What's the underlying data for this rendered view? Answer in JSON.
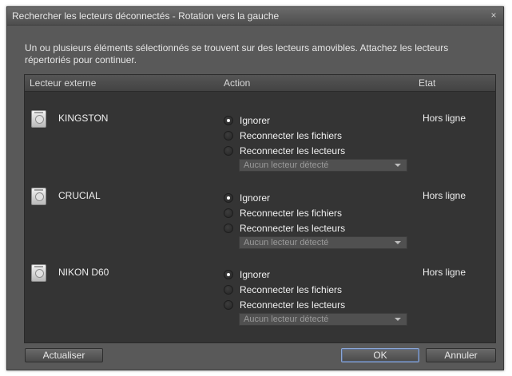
{
  "window": {
    "title": "Rechercher les lecteurs déconnectés - Rotation vers la gauche",
    "close_glyph": "×"
  },
  "message": "Un ou plusieurs éléments sélectionnés se trouvent sur des lecteurs amovibles. Attachez les lecteurs répertoriés pour continuer.",
  "table": {
    "headers": {
      "drive": "Lecteur externe",
      "action": "Action",
      "status": "Etat"
    },
    "rows": [
      {
        "icon": "removable-drive-icon",
        "name": "KINGSTON",
        "options": [
          "Ignorer",
          "Reconnecter les fichiers",
          "Reconnecter les lecteurs"
        ],
        "selected_option": "Ignorer",
        "dropdown": "Aucun lecteur détecté",
        "status": "Hors ligne"
      },
      {
        "icon": "removable-drive-icon",
        "name": "CRUCIAL",
        "options": [
          "Ignorer",
          "Reconnecter les fichiers",
          "Reconnecter les lecteurs"
        ],
        "selected_option": "Ignorer",
        "dropdown": "Aucun lecteur détecté",
        "status": "Hors ligne"
      },
      {
        "icon": "removable-drive-icon",
        "name": "NIKON D60",
        "options": [
          "Ignorer",
          "Reconnecter les fichiers",
          "Reconnecter les lecteurs"
        ],
        "selected_option": "Ignorer",
        "dropdown": "Aucun lecteur détecté",
        "status": "Hors ligne"
      }
    ]
  },
  "buttons": {
    "refresh": "Actualiser",
    "ok": "OK",
    "cancel": "Annuler"
  },
  "colors": {
    "dialog_bg": "#595959",
    "table_bg": "#343434",
    "focus_border": "#8aa6d6"
  }
}
